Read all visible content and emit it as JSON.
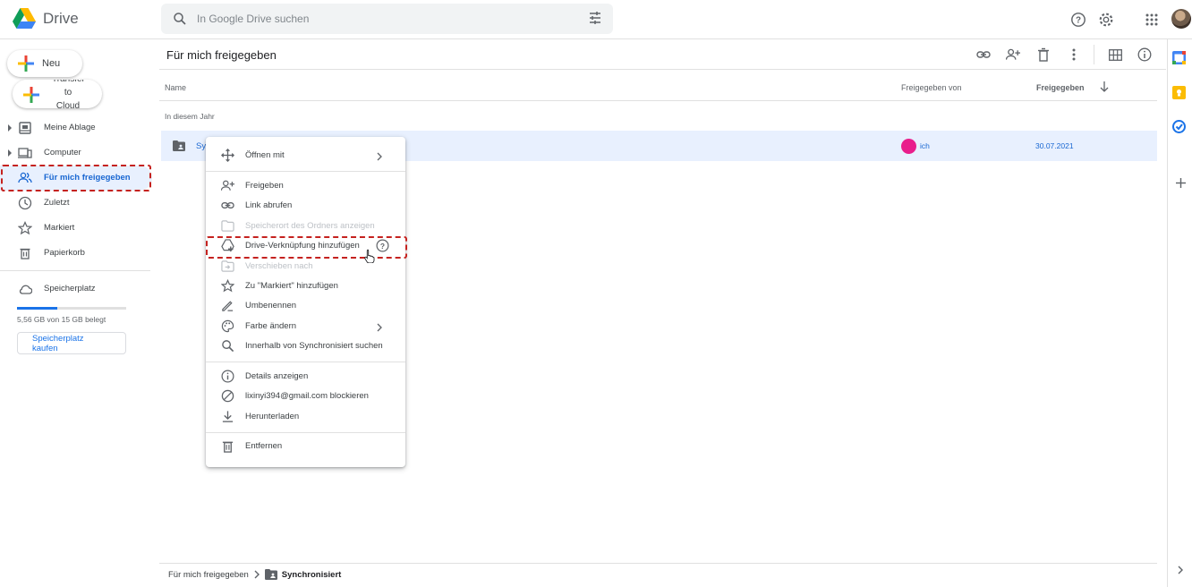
{
  "app": {
    "name": "Drive"
  },
  "search": {
    "placeholder": "In Google Drive suchen"
  },
  "sidebar": {
    "new_label": "Neu",
    "transfer_label": "Transfer to Cloud",
    "items": [
      {
        "label": "Meine Ablage",
        "icon": "my-drive-icon"
      },
      {
        "label": "Computer",
        "icon": "computer-icon"
      },
      {
        "label": "Für mich freigegeben",
        "icon": "shared-people-icon"
      },
      {
        "label": "Zuletzt",
        "icon": "clock-icon"
      },
      {
        "label": "Markiert",
        "icon": "star-icon"
      },
      {
        "label": "Papierkorb",
        "icon": "trash-icon"
      }
    ],
    "storage_label": "Speicherplatz",
    "storage_used_text": "5,56 GB von 15 GB belegt",
    "storage_used_fraction": 0.37,
    "buy_storage": "Speicherplatz kaufen"
  },
  "main": {
    "title": "Für mich freigegeben",
    "columns": {
      "name": "Name",
      "shared_by": "Freigegeben von",
      "shared_date": "Freigegeben"
    },
    "group": "In diesem Jahr",
    "rows": [
      {
        "name": "Sy",
        "shared_by": "ich",
        "date": "30.07.2021"
      }
    ]
  },
  "context_menu": {
    "open_with": "Öffnen mit",
    "share": "Freigeben",
    "get_link": "Link abrufen",
    "show_location": "Speicherort des Ordners anzeigen",
    "add_shortcut": "Drive-Verknüpfung hinzufügen",
    "move_to": "Verschieben nach",
    "add_starred": "Zu \"Markiert\" hinzufügen",
    "rename": "Umbenennen",
    "change_color": "Farbe ändern",
    "search_within": "Innerhalb von Synchronisiert suchen",
    "details": "Details anzeigen",
    "block": "lixinyi394@gmail.com blockieren",
    "download": "Herunterladen",
    "remove": "Entfernen"
  },
  "breadcrumb": {
    "root": "Für mich freigegeben",
    "current": "Synchronisiert"
  },
  "colors": {
    "accent": "#1a73e8",
    "highlight": "#c5221f",
    "row_selected": "#e8f0fe",
    "avatar_pink": "#e91e8c"
  }
}
